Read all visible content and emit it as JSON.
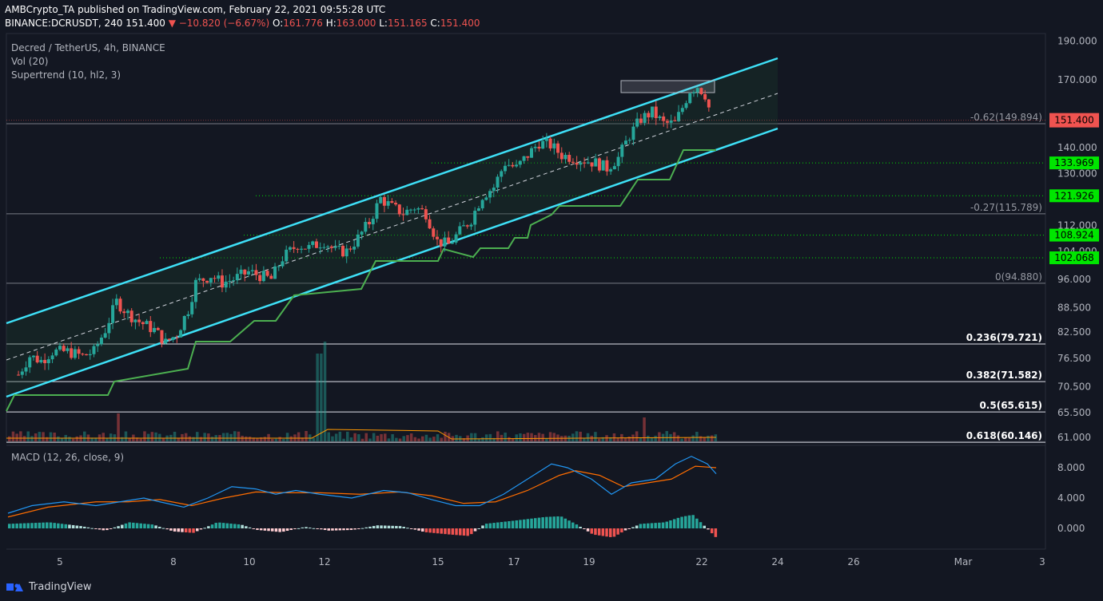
{
  "header": {
    "publisher_line": "AMBCrypto_TA published on TradingView.com, February 22, 2021 09:55:28 UTC",
    "symbol": "BINANCE:DCRUSDT, 240",
    "last": "151.400",
    "change": "▼ −10.820 (−6.67%)",
    "o_label": "O:",
    "o": "161.776",
    "h_label": "H:",
    "h": "163.000",
    "l_label": "L:",
    "l": "151.165",
    "c_label": "C:",
    "c": "151.400"
  },
  "legend": {
    "pair": "Decred / TetherUS, 4h, BINANCE",
    "vol": "Vol (20)",
    "supertrend": "Supertrend (10, hl2, 3)",
    "macd": "MACD (12, 26, close, 9)"
  },
  "footer": {
    "brand": "TradingView"
  },
  "colors": {
    "background": "#131722",
    "up": "#26a69a",
    "down": "#ef5350",
    "channel": "#3ee0f7",
    "supertrend": "#4caf50",
    "macd": "#2196f3",
    "signal": "#ff6d00",
    "green_label": "#00e600",
    "price_label": "#f05350"
  },
  "chart_data": {
    "type": "candlestick",
    "price_axis": {
      "ticks": [
        "190.000",
        "170.000",
        "140.000",
        "130.000",
        "112.000",
        "104.000",
        "96.000",
        "88.500",
        "82.500",
        "76.500",
        "70.500",
        "65.500",
        "61.000"
      ],
      "scale": "log"
    },
    "x_axis": {
      "ticks": [
        "5",
        "8",
        "10",
        "12",
        "15",
        "17",
        "19",
        "22",
        "24",
        "26",
        "Mar",
        "3"
      ]
    },
    "current_price": "151.400",
    "horizontal_levels": [
      {
        "label": "133.969",
        "value": 133.969
      },
      {
        "label": "121.926",
        "value": 121.926
      },
      {
        "label": "108.924",
        "value": 108.924
      },
      {
        "label": "102.068",
        "value": 102.068
      }
    ],
    "fib_levels": [
      {
        "label": "-0.62(149.894)",
        "value": 149.894
      },
      {
        "label": "-0.27(115.789)",
        "value": 115.789
      },
      {
        "label": "0(94.880)",
        "value": 94.88
      },
      {
        "label": "0.236(79.721)",
        "value": 79.721
      },
      {
        "label": "0.382(71.582)",
        "value": 71.582
      },
      {
        "label": "0.5(65.615)",
        "value": 65.615
      },
      {
        "label": "0.618(60.146)",
        "value": 60.146
      }
    ],
    "macd_axis": {
      "ticks": [
        "8.000",
        "4.000",
        "0.000"
      ]
    },
    "close_path": [
      [
        3.9,
        73
      ],
      [
        4.2,
        77
      ],
      [
        4.5,
        76
      ],
      [
        4.8,
        78
      ],
      [
        5.2,
        78
      ],
      [
        5.6,
        77
      ],
      [
        5.9,
        78
      ],
      [
        6.2,
        83
      ],
      [
        6.5,
        90
      ],
      [
        6.8,
        87
      ],
      [
        7.1,
        85
      ],
      [
        7.5,
        83
      ],
      [
        7.8,
        80
      ],
      [
        8.1,
        82
      ],
      [
        8.4,
        88
      ],
      [
        8.6,
        95
      ],
      [
        9.0,
        97
      ],
      [
        9.3,
        95
      ],
      [
        9.6,
        96
      ],
      [
        10.0,
        98
      ],
      [
        10.3,
        97
      ],
      [
        10.6,
        96
      ],
      [
        10.9,
        102
      ],
      [
        11.3,
        106
      ],
      [
        11.6,
        105
      ],
      [
        12.0,
        107
      ],
      [
        12.3,
        104
      ],
      [
        12.6,
        104
      ],
      [
        12.9,
        108
      ],
      [
        13.2,
        113
      ],
      [
        13.5,
        121
      ],
      [
        13.8,
        118
      ],
      [
        14.1,
        116
      ],
      [
        14.4,
        118
      ],
      [
        14.7,
        116
      ],
      [
        15.0,
        107
      ],
      [
        15.3,
        106
      ],
      [
        15.6,
        110
      ],
      [
        15.9,
        114
      ],
      [
        16.2,
        122
      ],
      [
        16.5,
        125
      ],
      [
        16.8,
        134
      ],
      [
        17.1,
        132
      ],
      [
        17.4,
        137
      ],
      [
        17.7,
        142
      ],
      [
        18.0,
        141
      ],
      [
        18.3,
        137
      ],
      [
        18.6,
        136
      ],
      [
        18.9,
        135
      ],
      [
        19.2,
        134
      ],
      [
        19.5,
        132
      ],
      [
        19.8,
        136
      ],
      [
        20.1,
        145
      ],
      [
        20.4,
        152
      ],
      [
        20.7,
        155
      ],
      [
        21.0,
        150
      ],
      [
        21.3,
        150
      ],
      [
        21.5,
        157
      ],
      [
        21.7,
        165
      ],
      [
        21.9,
        167
      ],
      [
        22.1,
        163
      ],
      [
        22.3,
        151
      ]
    ],
    "pattern_note": ""
  }
}
